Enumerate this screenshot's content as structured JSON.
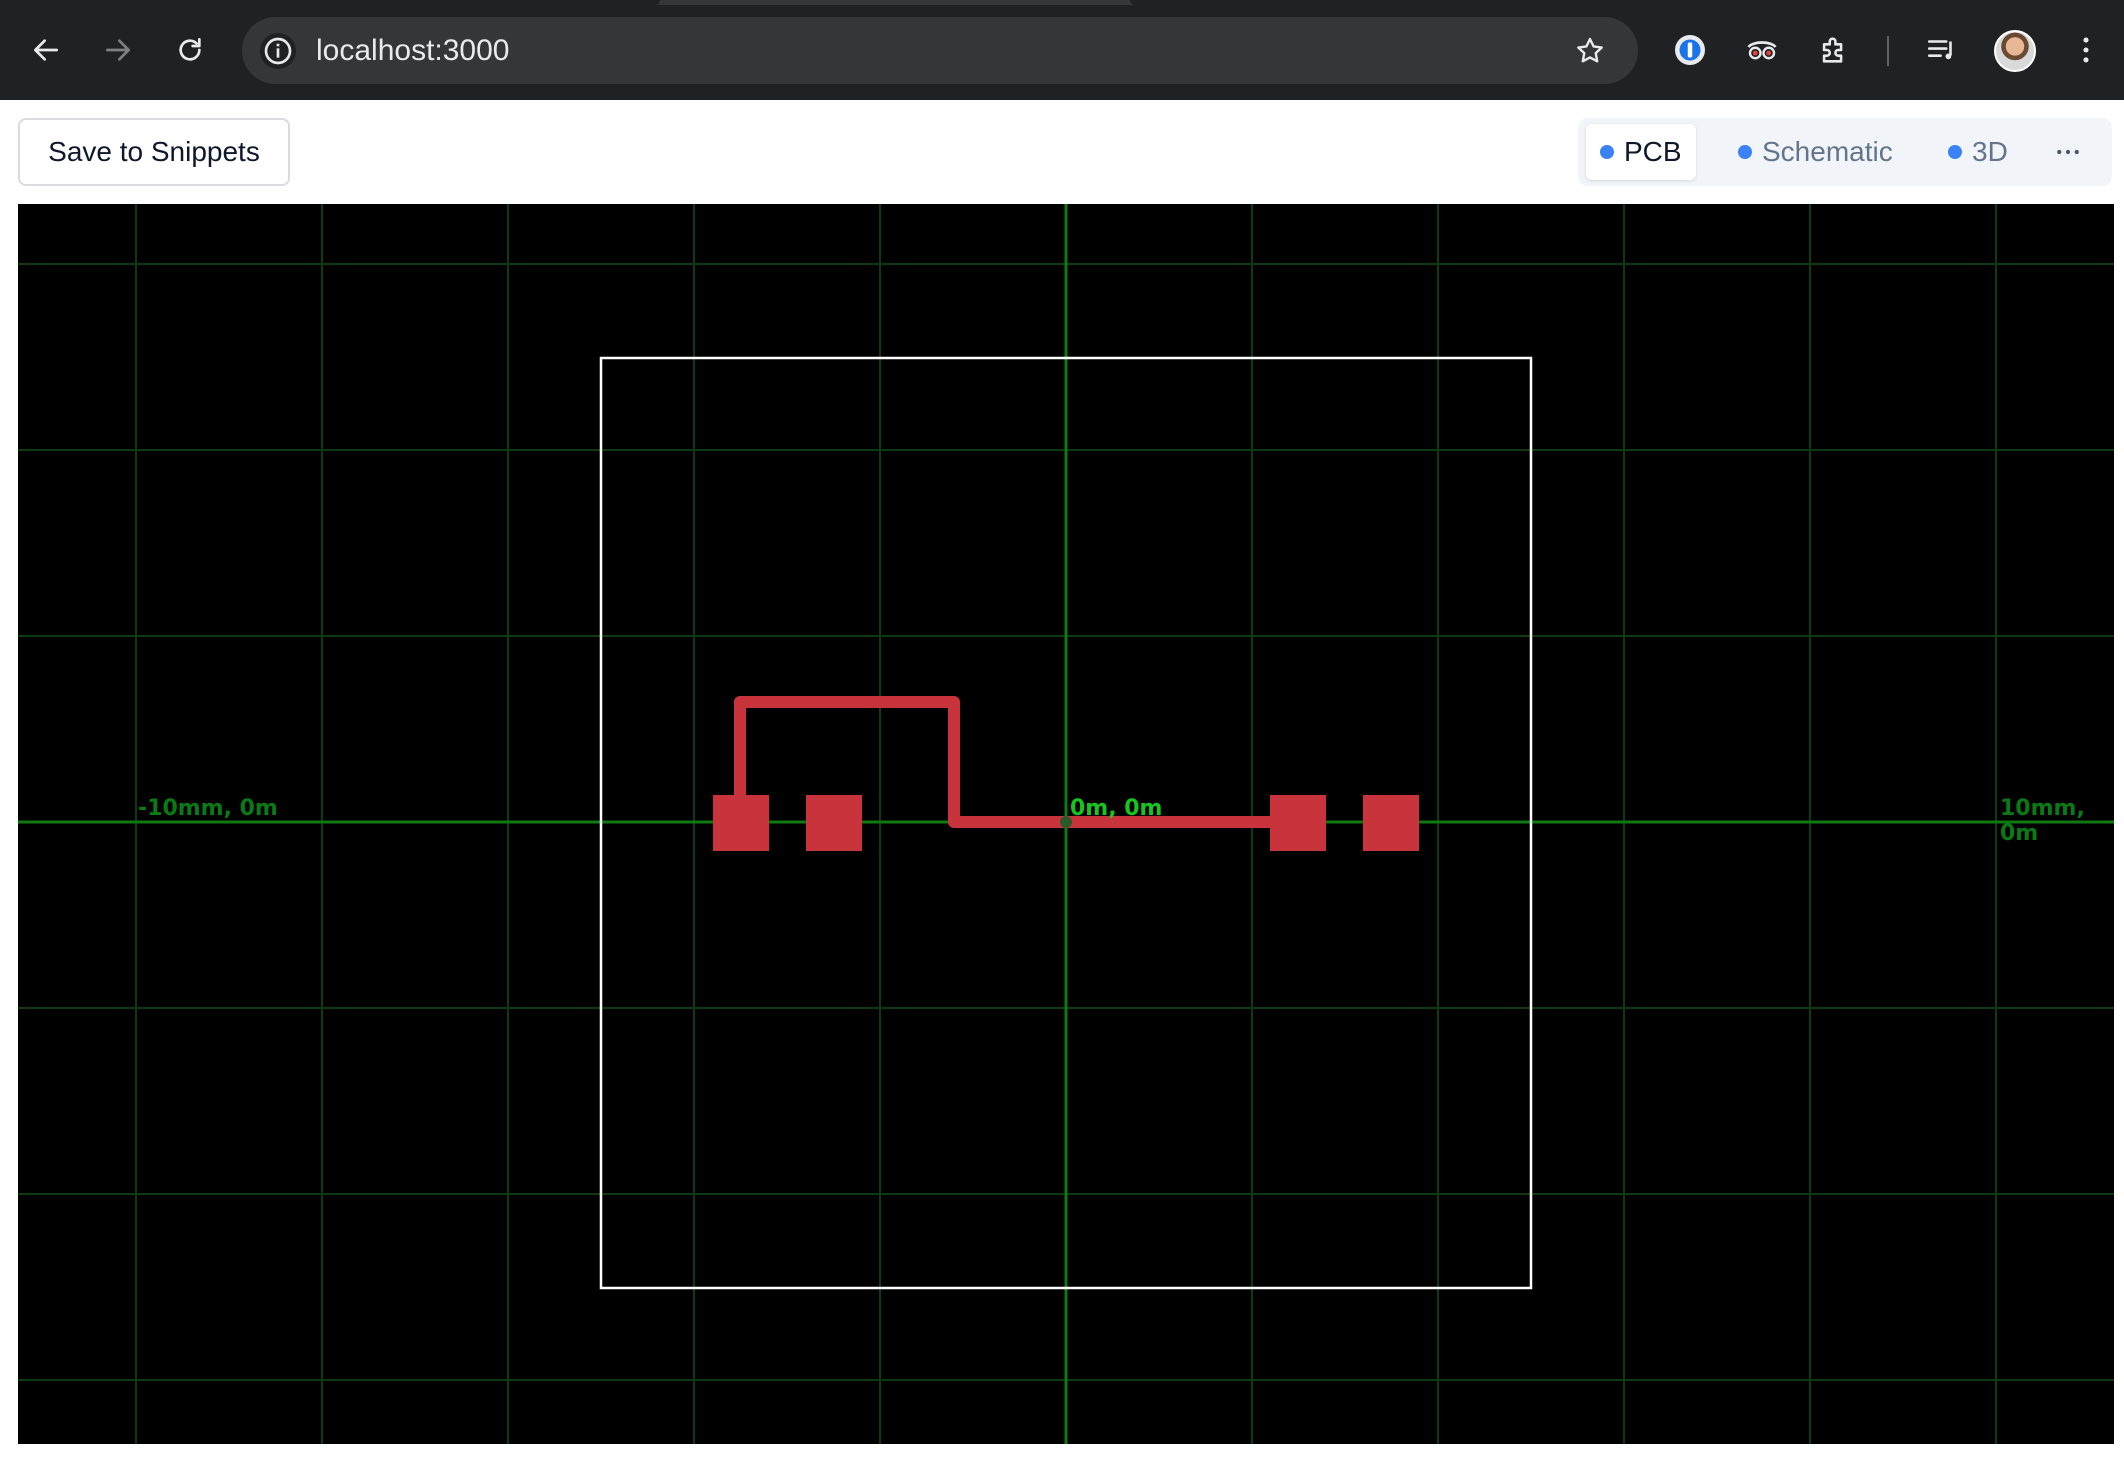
{
  "browser": {
    "url": "localhost:3000",
    "icons": [
      "back-arrow-icon",
      "forward-arrow-icon",
      "reload-icon",
      "site-info-icon",
      "bookmark-star-icon",
      "password-manager-icon",
      "extension-glasses-icon",
      "extensions-puzzle-icon",
      "media-queue-icon",
      "profile-avatar",
      "menu-kebab-icon"
    ]
  },
  "toolbar": {
    "save_label": "Save to Snippets",
    "tabs": [
      {
        "label": "PCB",
        "active": true
      },
      {
        "label": "Schematic",
        "active": false
      },
      {
        "label": "3D",
        "active": false
      }
    ],
    "more_icon": "more-horizontal-icon",
    "accent_color": "#3b82f6"
  },
  "pcb": {
    "background_color": "#000000",
    "board_outline_color": "#ffffff",
    "trace_color": "#c9333b",
    "grid_color": "#0d3a10",
    "axis_color": "#0f7a12",
    "labels": {
      "left": "-10mm, 0m",
      "origin": "0m, 0m",
      "right": "10mm, 0m"
    }
  }
}
